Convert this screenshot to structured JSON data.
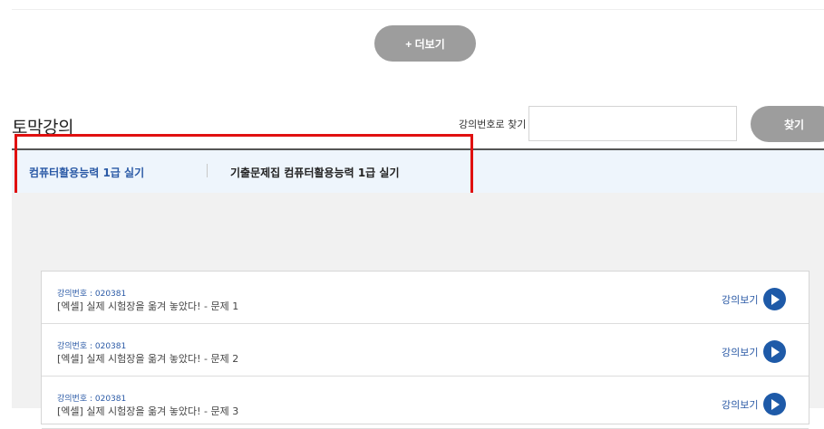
{
  "more_button": {
    "label": "+ 더보기"
  },
  "section": {
    "title": "토막강의"
  },
  "search": {
    "label": "강의번호로 찾기",
    "placeholder": "",
    "value": "",
    "button_label": "찾기"
  },
  "tabs": [
    {
      "label": "컴퓨터활용능력 1급 실기",
      "active": true
    },
    {
      "label": "기출문제집 컴퓨터활용능력 1급 실기",
      "active": false
    }
  ],
  "lectures": [
    {
      "number": "강의번호 : 020381",
      "title": "[엑셀] 실제 시험장을 옮겨 놓았다! - 문제 1",
      "action": "강의보기"
    },
    {
      "number": "강의번호 : 020381",
      "title": "[엑셀] 실제 시험장을 옮겨 놓았다! - 문제 2",
      "action": "강의보기"
    },
    {
      "number": "강의번호 : 020381",
      "title": "[엑셀] 실제 시험장을 옮겨 놓았다! - 문제 3",
      "action": "강의보기"
    }
  ],
  "colors": {
    "accent": "#2b5aa6",
    "button_gray": "#9d9d9d",
    "highlight": "#e01010",
    "tab_bg": "#eef5fc"
  },
  "icons": {
    "play": "play-icon"
  }
}
